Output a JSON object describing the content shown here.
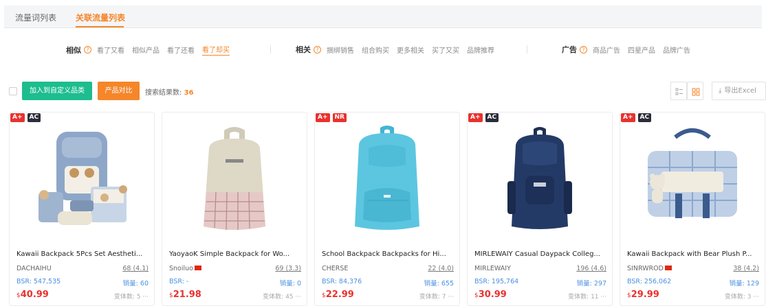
{
  "tabs": [
    "流量词列表",
    "关联流量列表"
  ],
  "filters": {
    "similar": {
      "label": "相似",
      "items": [
        "看了又看",
        "相似产品",
        "看了还看",
        "看了却买"
      ],
      "active_index": 3
    },
    "related": {
      "label": "相关",
      "items": [
        "捆绑销售",
        "组合购买",
        "更多相关",
        "买了又买",
        "品牌推荐"
      ]
    },
    "ads": {
      "label": "广告",
      "items": [
        "商品广告",
        "四星产品",
        "品牌广告"
      ]
    }
  },
  "toolbar": {
    "add_category_label": "加入到自定义品类",
    "compare_label": "产品对比",
    "result_prefix": "搜索结果数:",
    "result_count": "36",
    "export_label": "导出Excel"
  },
  "colors": {
    "accent": "#f5862a",
    "green": "#1dbd8f",
    "price": "#e8322f",
    "link": "#4a90e2"
  },
  "products": [
    {
      "badges": [
        "A+",
        "AC"
      ],
      "title": "Kawaii Backpack 5Pcs Set Aestheti...",
      "brand": "DACHAIHU",
      "flag": false,
      "reviews": "68 (4.1)",
      "bsr": "BSR: 547,535",
      "sales_label": "销量:",
      "sales": "60",
      "currency": "$",
      "price": "40.99",
      "variants": "变体数: 5",
      "image": "blue-backpack-set-with-bears"
    },
    {
      "badges": [],
      "title": "YaoyaoK Simple Backpack for Wo...",
      "brand": "Snoiluo",
      "flag": true,
      "reviews": "69 (3.3)",
      "bsr": "BSR: -",
      "sales_label": "销量:",
      "sales": "0",
      "currency": "$",
      "price": "21.98",
      "variants": "变体数: 45",
      "image": "beige-plaid-backpack"
    },
    {
      "badges": [
        "A+",
        "NR"
      ],
      "title": "School Backpack Backpacks for Hi...",
      "brand": "CHERSE",
      "flag": false,
      "reviews": "22 (4.0)",
      "bsr": "BSR: 84,376",
      "sales_label": "销量:",
      "sales": "655",
      "currency": "$",
      "price": "22.99",
      "variants": "变体数: 7",
      "image": "light-blue-backpack"
    },
    {
      "badges": [
        "A+",
        "AC"
      ],
      "title": "MIRLEWAIY Casual Daypack Colleg...",
      "brand": "MIRLEWAIY",
      "flag": false,
      "reviews": "196 (4.6)",
      "bsr": "BSR: 195,764",
      "sales_label": "销量:",
      "sales": "297",
      "currency": "$",
      "price": "30.99",
      "variants": "变体数: 11",
      "image": "navy-daypack"
    },
    {
      "badges": [
        "A+",
        "AC"
      ],
      "title": "Kawaii Backpack with Bear Plush P...",
      "brand": "SINRWROD",
      "flag": true,
      "reviews": "38 (4.2)",
      "bsr": "BSR: 256,062",
      "sales_label": "销量:",
      "sales": "129",
      "currency": "$",
      "price": "29.99",
      "variants": "变体数: 3",
      "image": "plaid-bag-with-bear"
    }
  ]
}
